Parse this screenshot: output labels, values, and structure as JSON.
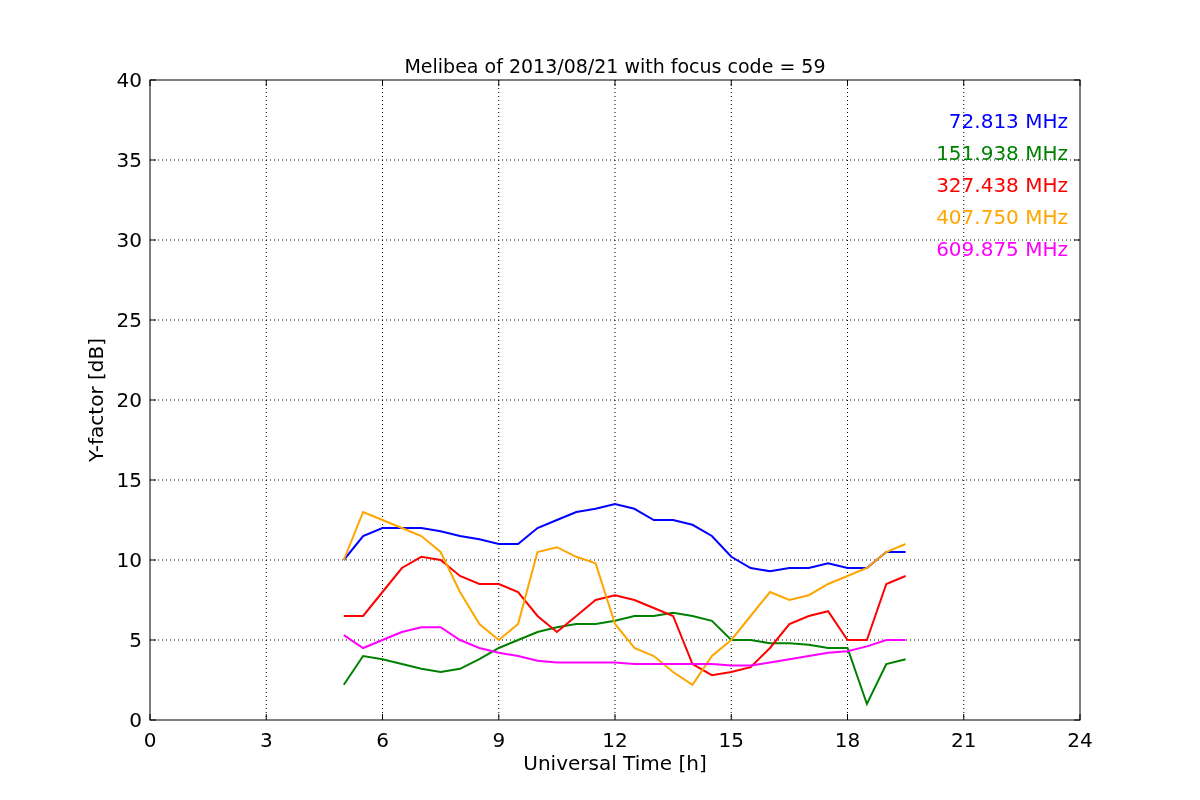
{
  "figure": {
    "chart_data": {
      "type": "line",
      "title": "Melibea of 2013/08/21 with focus code = 59",
      "xlabel": "Universal Time [h]",
      "ylabel": "Y-factor [dB]",
      "x": [
        5,
        5.5,
        6,
        6.5,
        7,
        7.5,
        8,
        8.5,
        9,
        9.5,
        10,
        10.5,
        11,
        11.5,
        12,
        12.5,
        13,
        13.5,
        14,
        14.5,
        15,
        15.5,
        16,
        16.5,
        17,
        17.5,
        18,
        18.5,
        19,
        19.5
      ],
      "series": [
        {
          "name": "72.813 MHz",
          "color": "#0000ff",
          "values": [
            10,
            11.5,
            12,
            12,
            12,
            11.8,
            11.5,
            11.3,
            11,
            11,
            12,
            12.5,
            13,
            13.2,
            13.5,
            13.2,
            12.5,
            12.5,
            12.2,
            11.5,
            10.2,
            9.5,
            9.3,
            9.5,
            9.5,
            9.8,
            9.5,
            9.5,
            10.5,
            10.5
          ]
        },
        {
          "name": "151.938 MHz",
          "color": "#008000",
          "values": [
            2.2,
            4,
            3.8,
            3.5,
            3.2,
            3,
            3.2,
            3.8,
            4.5,
            5,
            5.5,
            5.8,
            6,
            6,
            6.2,
            6.5,
            6.5,
            6.7,
            6.5,
            6.2,
            5,
            5,
            4.8,
            4.8,
            4.7,
            4.5,
            4.5,
            1,
            3.5,
            3.8
          ]
        },
        {
          "name": "327.438 MHz",
          "color": "#ff0000",
          "values": [
            6.5,
            6.5,
            8,
            9.5,
            10.2,
            10,
            9,
            8.5,
            8.5,
            8,
            6.5,
            5.5,
            6.5,
            7.5,
            7.8,
            7.5,
            7,
            6.5,
            3.5,
            2.8,
            3,
            3.3,
            4.5,
            6,
            6.5,
            6.8,
            5,
            5,
            8.5,
            9
          ]
        },
        {
          "name": "407.750 MHz",
          "color": "#ffa500",
          "values": [
            10,
            13,
            12.5,
            12,
            11.5,
            10.5,
            8,
            6,
            5,
            6,
            10.5,
            10.8,
            10.2,
            9.8,
            6,
            4.5,
            4,
            3,
            2.2,
            4,
            5,
            6.5,
            8,
            7.5,
            7.8,
            8.5,
            9,
            9.5,
            10.5,
            11
          ]
        },
        {
          "name": "609.875 MHz",
          "color": "#ff00ff",
          "values": [
            5.3,
            4.5,
            5,
            5.5,
            5.8,
            5.8,
            5,
            4.5,
            4.2,
            4,
            3.7,
            3.6,
            3.6,
            3.6,
            3.6,
            3.5,
            3.5,
            3.5,
            3.5,
            3.5,
            3.4,
            3.4,
            3.6,
            3.8,
            4,
            4.2,
            4.3,
            4.6,
            5,
            5
          ]
        }
      ],
      "grid": true,
      "xlim": [
        0,
        24
      ],
      "ylim": [
        0,
        40
      ],
      "xticks": [
        0,
        3,
        6,
        9,
        12,
        15,
        18,
        21,
        24
      ],
      "yticks": [
        0,
        5,
        10,
        15,
        20,
        25,
        30,
        35,
        40
      ]
    }
  }
}
